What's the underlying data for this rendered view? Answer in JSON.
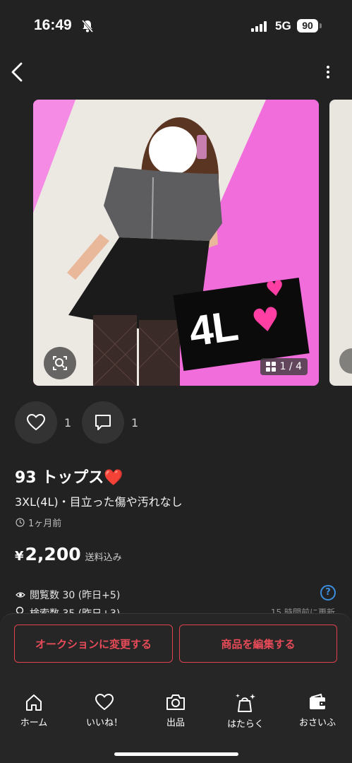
{
  "status_bar": {
    "time": "16:49",
    "network": "5G",
    "battery": "90"
  },
  "nav": {
    "back_icon": "chevron-left-icon",
    "more_icon": "more-vertical-icon"
  },
  "photo": {
    "overlay_text": "4L",
    "counter": "1 / 4",
    "colors": {
      "background": "#f26ddc",
      "tag": "#0b0b0b",
      "heart": "#ff3fa3"
    }
  },
  "social": {
    "likes": "1",
    "comments": "1"
  },
  "item": {
    "title": "93 トップス❤️",
    "condition": "3XL(4L)・目立った傷や汚れなし",
    "posted": "1ヶ月前",
    "currency": "¥",
    "price": "2,200",
    "shipping": "送料込み"
  },
  "stats": {
    "views": "閲覧数 30 (昨日+5)",
    "searches": "検索数 35 (昨日+3)",
    "updated": "15 時間前に更新"
  },
  "actions": {
    "auction": "オークションに変更する",
    "edit": "商品を編集する",
    "accent": "#e0424f"
  },
  "tabs": [
    {
      "label": "ホーム",
      "icon": "home-icon"
    },
    {
      "label": "いいね！",
      "icon": "heart-icon"
    },
    {
      "label": "出品",
      "icon": "camera-icon"
    },
    {
      "label": "はたらく",
      "icon": "sparkle-bag-icon"
    },
    {
      "label": "おさいふ",
      "icon": "wallet-icon"
    }
  ]
}
